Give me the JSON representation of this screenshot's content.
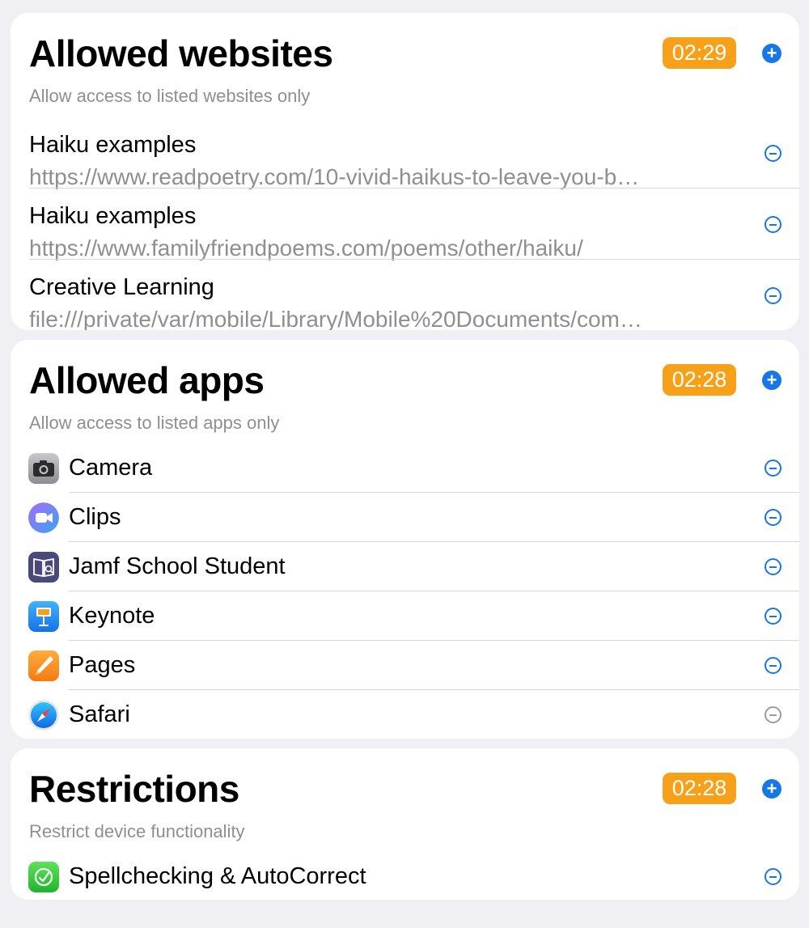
{
  "websites": {
    "title": "Allowed websites",
    "timer": "02:29",
    "subtitle": "Allow access to listed websites only",
    "items": [
      {
        "name": "Haiku examples",
        "url": "https://www.readpoetry.com/10-vivid-haikus-to-leave-you-b…"
      },
      {
        "name": "Haiku examples",
        "url": "https://www.familyfriendpoems.com/poems/other/haiku/"
      },
      {
        "name": "Creative Learning",
        "url": "file:///private/var/mobile/Library/Mobile%20Documents/com…"
      }
    ]
  },
  "apps": {
    "title": "Allowed apps",
    "timer": "02:28",
    "subtitle": "Allow access to listed apps only",
    "items": [
      {
        "name": "Camera",
        "icon": "camera-icon"
      },
      {
        "name": "Clips",
        "icon": "clips-icon"
      },
      {
        "name": "Jamf School Student",
        "icon": "jamf-school-student-icon"
      },
      {
        "name": "Keynote",
        "icon": "keynote-icon"
      },
      {
        "name": "Pages",
        "icon": "pages-icon"
      },
      {
        "name": "Safari",
        "icon": "safari-icon"
      }
    ]
  },
  "restrictions": {
    "title": "Restrictions",
    "timer": "02:28",
    "subtitle": "Restrict device functionality",
    "items": [
      {
        "name": "Spellchecking & AutoCorrect",
        "icon": "spellcheck-icon"
      }
    ]
  },
  "colors": {
    "accent": "#1677e5",
    "timer": "#f7a01a",
    "secondary_text": "#8e8e93",
    "background": "#efeff4"
  }
}
